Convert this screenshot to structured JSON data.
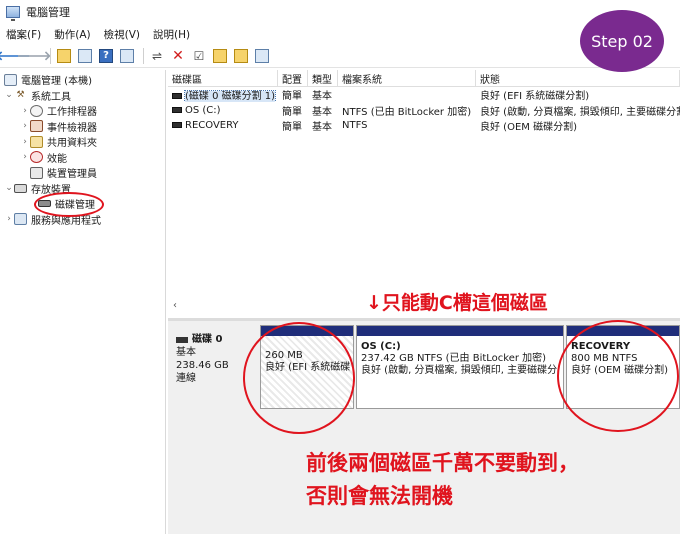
{
  "window": {
    "title": "電腦管理"
  },
  "menu": [
    "檔案(F)",
    "動作(A)",
    "檢視(V)",
    "說明(H)"
  ],
  "step_badge": "Step 02",
  "tree": {
    "items": [
      {
        "label": "電腦管理 (本機)",
        "icon": "computer-icon",
        "level": 0,
        "chevron": ""
      },
      {
        "label": "系統工具",
        "icon": "tools-icon",
        "level": 1,
        "chevron": "expanded"
      },
      {
        "label": "工作排程器",
        "icon": "clock-icon",
        "level": 2,
        "chevron": "collapsed"
      },
      {
        "label": "事件檢視器",
        "icon": "event-viewer-icon",
        "level": 2,
        "chevron": "collapsed"
      },
      {
        "label": "共用資料夾",
        "icon": "shared-folder-icon",
        "level": 2,
        "chevron": "collapsed"
      },
      {
        "label": "效能",
        "icon": "performance-icon",
        "level": 2,
        "chevron": "collapsed"
      },
      {
        "label": "裝置管理員",
        "icon": "device-manager-icon",
        "level": 2,
        "chevron": ""
      },
      {
        "label": "存放裝置",
        "icon": "storage-icon",
        "level": 1,
        "chevron": "expanded"
      },
      {
        "label": "磁碟管理",
        "icon": "disk-management-icon",
        "level": 2,
        "chevron": ""
      },
      {
        "label": "服務與應用程式",
        "icon": "services-icon",
        "level": 1,
        "chevron": "collapsed"
      }
    ]
  },
  "volume_list": {
    "columns": [
      "磁碟區",
      "配置",
      "類型",
      "檔案系統",
      "狀態"
    ],
    "rows": [
      {
        "volume": "(磁碟 0 磁碟分割 1)",
        "layout": "簡單",
        "type": "基本",
        "fs": "",
        "status": "良好 (EFI 系統磁碟分割)"
      },
      {
        "volume": "OS (C:)",
        "layout": "簡單",
        "type": "基本",
        "fs": "NTFS (已由 BitLocker 加密)",
        "status": "良好 (啟動, 分頁檔案, 損毀傾印, 主要磁碟分割)"
      },
      {
        "volume": "RECOVERY",
        "layout": "簡單",
        "type": "基本",
        "fs": "NTFS",
        "status": "良好 (OEM 磁碟分割)"
      }
    ]
  },
  "disk": {
    "name": "磁碟 0",
    "type": "基本",
    "size": "238.46 GB",
    "state": "連線",
    "partitions": [
      {
        "name": "",
        "size": "260 MB",
        "status": "良好 (EFI 系統磁碟"
      },
      {
        "name": "OS  (C:)",
        "size": "237.42 GB NTFS (已由 BitLocker 加密)",
        "status": "良好 (啟動, 分頁檔案, 損毀傾印, 主要磁碟分"
      },
      {
        "name": "RECOVERY",
        "size": "800 MB NTFS",
        "status": "良好 (OEM 磁碟分割)"
      }
    ]
  },
  "annotations": {
    "top": "↓只能動C槽這個磁區",
    "bottom_line1": "前後兩個磁區千萬不要動到，",
    "bottom_line2": "否則會無法開機"
  },
  "colors": {
    "annotation": "#e0141e",
    "badge": "#7a2a8f",
    "partition_band": "#1f2d7a"
  }
}
